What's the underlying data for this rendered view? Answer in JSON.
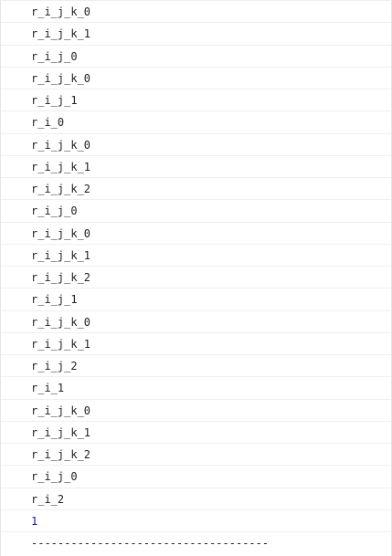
{
  "console": {
    "lines": [
      {
        "text": "r_i_j_k_0",
        "type": "log"
      },
      {
        "text": "r_i_j_k_1",
        "type": "log"
      },
      {
        "text": "r_i_j_0",
        "type": "log"
      },
      {
        "text": "r_i_j_k_0",
        "type": "log"
      },
      {
        "text": "r_i_j_1",
        "type": "log"
      },
      {
        "text": "r_i_0",
        "type": "log"
      },
      {
        "text": "r_i_j_k_0",
        "type": "log"
      },
      {
        "text": "r_i_j_k_1",
        "type": "log"
      },
      {
        "text": "r_i_j_k_2",
        "type": "log"
      },
      {
        "text": "r_i_j_0",
        "type": "log"
      },
      {
        "text": "r_i_j_k_0",
        "type": "log"
      },
      {
        "text": "r_i_j_k_1",
        "type": "log"
      },
      {
        "text": "r_i_j_k_2",
        "type": "log"
      },
      {
        "text": "r_i_j_1",
        "type": "log"
      },
      {
        "text": "r_i_j_k_0",
        "type": "log"
      },
      {
        "text": "r_i_j_k_1",
        "type": "log"
      },
      {
        "text": "r_i_j_2",
        "type": "log"
      },
      {
        "text": "r_i_1",
        "type": "log"
      },
      {
        "text": "r_i_j_k_0",
        "type": "log"
      },
      {
        "text": "r_i_j_k_1",
        "type": "log"
      },
      {
        "text": "r_i_j_k_2",
        "type": "log"
      },
      {
        "text": "r_i_j_0",
        "type": "log"
      },
      {
        "text": "r_i_2",
        "type": "log"
      },
      {
        "text": "1",
        "type": "number"
      },
      {
        "text": "------------------------------------",
        "type": "separator"
      }
    ]
  }
}
